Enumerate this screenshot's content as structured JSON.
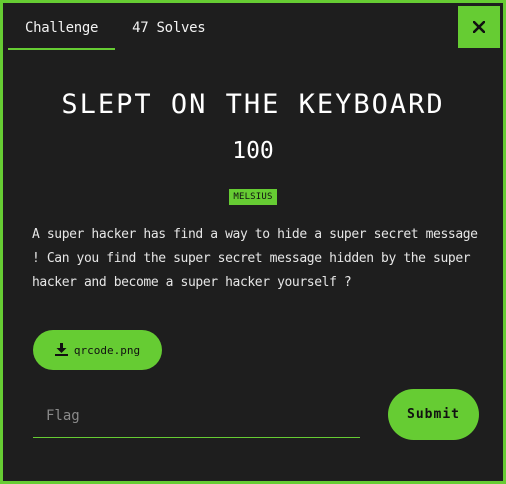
{
  "tabs": [
    {
      "label": "Challenge",
      "active": true
    },
    {
      "label": "47 Solves",
      "active": false
    }
  ],
  "close": {
    "icon": "close-icon",
    "glyph": "×"
  },
  "challenge": {
    "title": "SLEPT ON THE KEYBOARD",
    "points": "100",
    "author": "MELSIUS",
    "description": "A super hacker has find a way to hide a super secret message ! Can you find the super secret message hidden by the super hacker and become a super hacker yourself ?"
  },
  "file": {
    "icon": "download-icon",
    "label": "qrcode.png"
  },
  "flag_input": {
    "placeholder": "Flag",
    "value": ""
  },
  "submit": {
    "label": "Submit"
  },
  "colors": {
    "accent": "#66cc33",
    "background": "#1e1e1e",
    "text": "#ffffff"
  }
}
